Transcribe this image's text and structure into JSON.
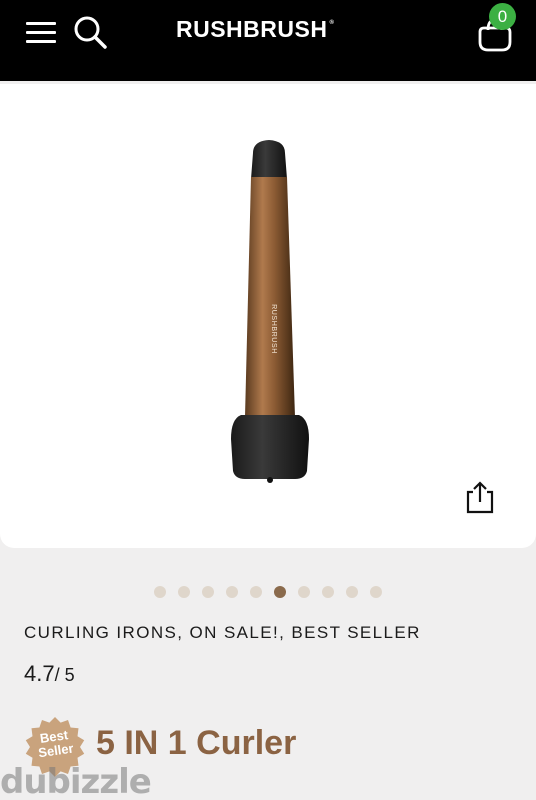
{
  "header": {
    "brand": "RUSHBRUSH",
    "brand_mark": "®",
    "cart_count": "0",
    "icons": [
      "menu-icon",
      "search-icon",
      "shopping-bag-icon"
    ]
  },
  "product": {
    "image_icon": "curling-iron-image",
    "share_icon": "share-icon",
    "carousel": {
      "total": 10,
      "active_index": 5
    },
    "tags": "CURLING IRONS,  ON SALE!,  BEST SELLER",
    "rating_value": "4.7",
    "rating_max": "/ 5",
    "badge_line1": "Best",
    "badge_line2": "Seller",
    "title": "5 IN 1 Curler"
  },
  "watermark": "dubizzle",
  "colors": {
    "header_bg": "#000000",
    "badge_green": "#3cb043",
    "title_brown": "#8b6343",
    "dot_active": "#8a6a4c",
    "dot_inactive": "#dfd6cb",
    "seller_badge": "#c9a37d"
  }
}
